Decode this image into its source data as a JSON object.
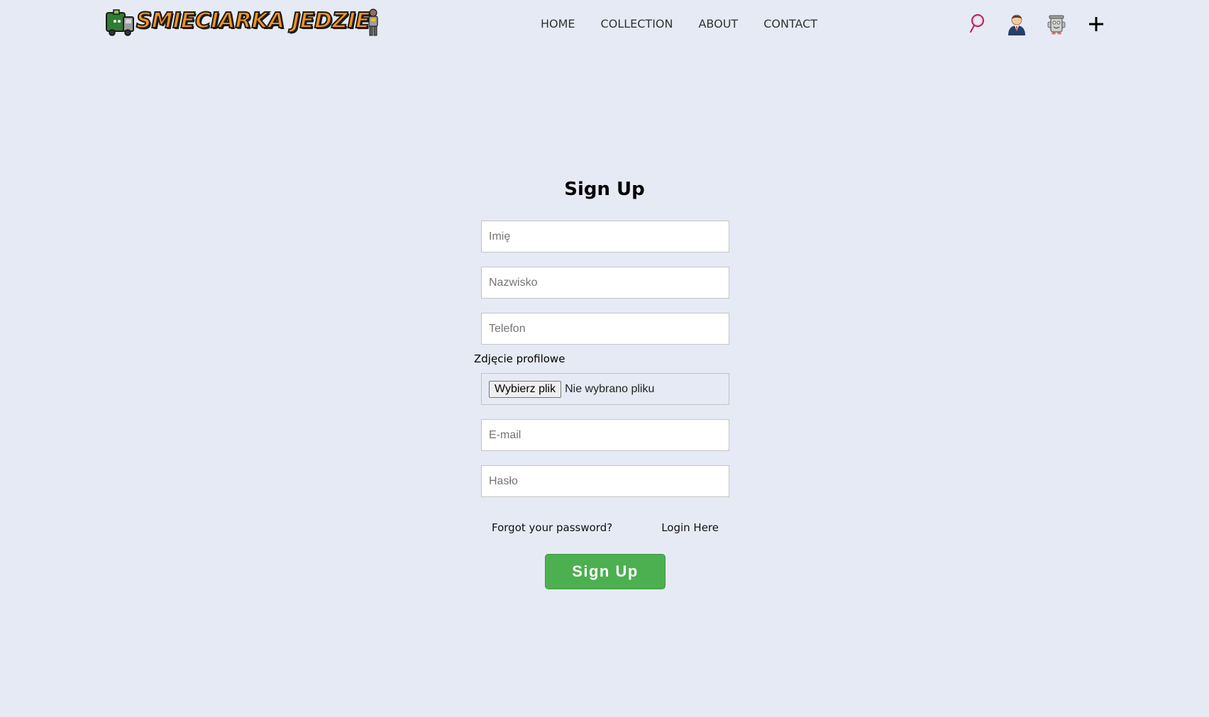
{
  "header": {
    "logo_text": "SMIECIARKA JEDZIE",
    "nav": [
      {
        "label": "HOME"
      },
      {
        "label": "COLLECTION"
      },
      {
        "label": "ABOUT"
      },
      {
        "label": "CONTACT"
      }
    ],
    "icons": [
      "search-icon",
      "profile-icon",
      "bin-mascot-icon",
      "plus-icon"
    ]
  },
  "form": {
    "title": "Sign Up",
    "fields": {
      "first_name": {
        "placeholder": "Imię",
        "value": ""
      },
      "last_name": {
        "placeholder": "Nazwisko",
        "value": ""
      },
      "phone": {
        "placeholder": "Telefon",
        "value": ""
      },
      "email": {
        "placeholder": "E-mail",
        "value": ""
      },
      "password": {
        "placeholder": "Hasło",
        "value": ""
      }
    },
    "photo": {
      "label": "Zdjęcie profilowe",
      "button": "Wybierz plik",
      "status": "Nie wybrano pliku"
    },
    "forgot_password": "Forgot your password?",
    "login_link": "Login Here",
    "submit": "Sign Up"
  },
  "colors": {
    "background": "#e6eaf5",
    "submit_button": "#4caf50",
    "logo_orange": "#f7941d"
  }
}
